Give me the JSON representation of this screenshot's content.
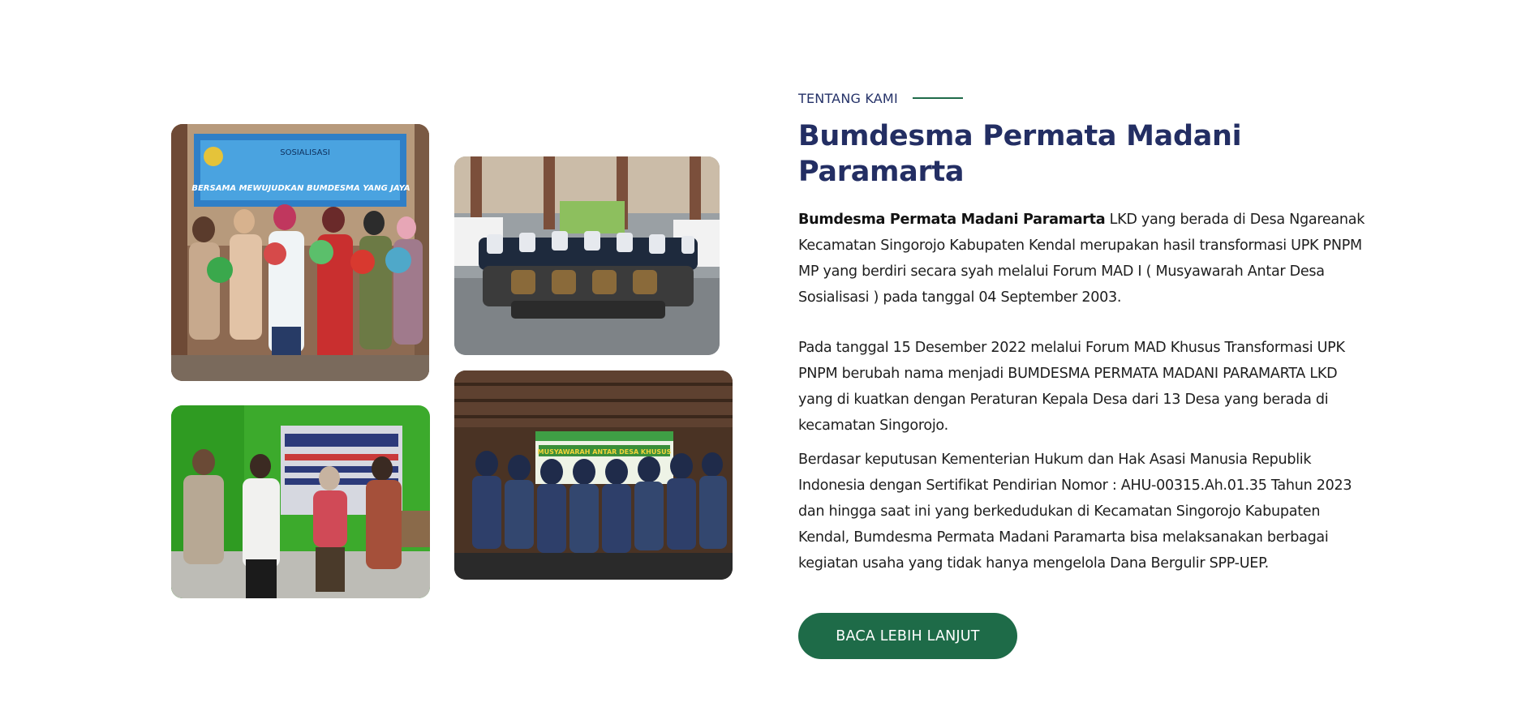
{
  "about": {
    "eyebrow": "TENTANG KAMI",
    "title": "Bumdesma Permata Madani Paramarta",
    "paragraph_1_bold": "Bumdesma Permata Madani Paramarta",
    "paragraph_1_rest": " LKD yang berada di Desa Ngareanak Kecamatan Singorojo Kabupaten Kendal merupakan hasil transformasi UPK PNPM MP yang berdiri secara syah melalui Forum MAD I ( Musyawarah Antar Desa Sosialisasi ) pada tanggal 04 September 2003.",
    "paragraph_2": "Pada tanggal 15 Desember 2022 melalui Forum MAD Khusus Transformasi UPK PNPM berubah nama menjadi BUMDESMA PERMATA MADANI PARAMARTA LKD yang di kuatkan dengan Peraturan Kepala Desa dari 13 Desa yang berada di kecamatan Singorojo.",
    "paragraph_3": "Berdasar keputusan Kementerian Hukum dan Hak Asasi Manusia Republik Indonesia dengan Sertifikat Pendirian Nomor : AHU-00315.Ah.01.35 Tahun 2023 dan hingga saat ini yang berkedudukan di Kecamatan Singorojo Kabupaten Kendal, Bumdesma Permata Madani Paramarta bisa melaksanakan berbagai kegiatan usaha yang tidak hanya mengelola Dana Bergulir SPP-UEP.",
    "button_label": "BACA LEBIH LANJUT"
  },
  "photos": {
    "photo_1": {
      "banner_line_1": "SOSIALISASI",
      "banner_line_2": "BERSAMA MEWUJUDKAN BUMDESMA YANG JAYA"
    },
    "photo_4": {
      "banner_line_1": "MUSYAWARAH ANTAR DESA KHUSUS"
    }
  },
  "colors": {
    "title": "#232e63",
    "eyebrow": "#253268",
    "accent_line": "#1f6b4a",
    "button_bg": "#1e6b48",
    "button_text": "#ffffff",
    "body_text": "#1e1e1e"
  }
}
